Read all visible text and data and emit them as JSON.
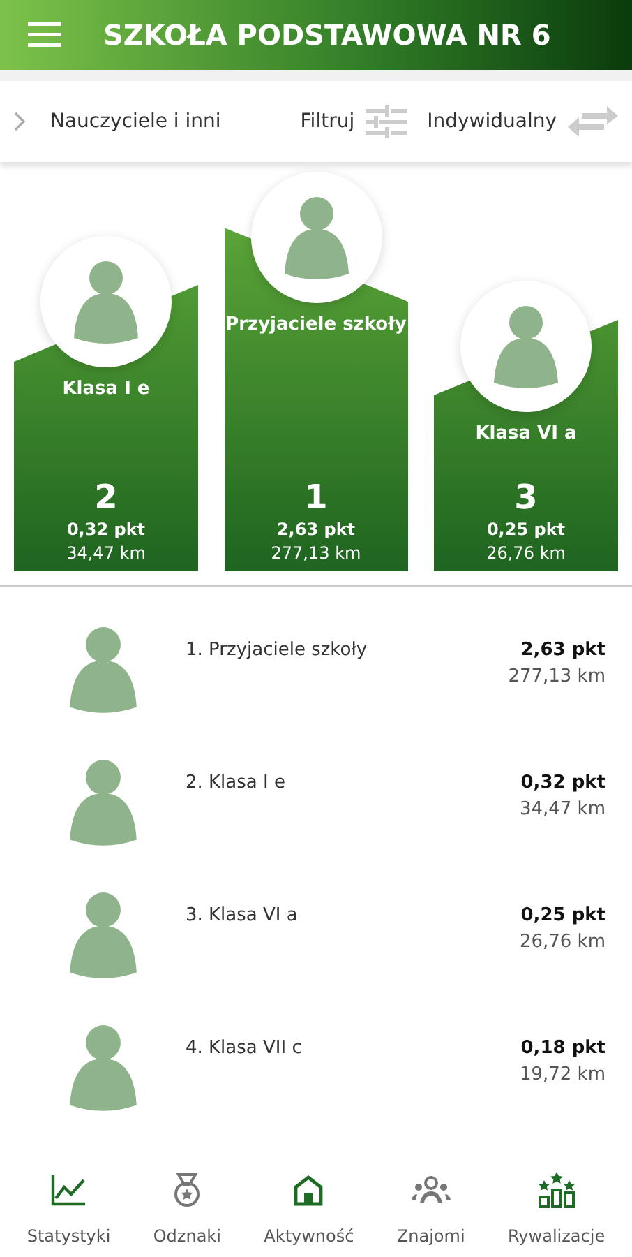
{
  "header": {
    "title": "SZKOŁA PODSTAWOWA NR 6"
  },
  "filter_bar": {
    "group": "Nauczyciele i inni",
    "filter": "Filtruj",
    "mode": "Indywidualny"
  },
  "podium": [
    {
      "name": "Klasa I e",
      "rank": "2",
      "points": "0,32 pkt",
      "distance": "34,47 km"
    },
    {
      "name": "Przyjaciele szkoły",
      "rank": "1",
      "points": "2,63 pkt",
      "distance": "277,13 km"
    },
    {
      "name": "Klasa VI a",
      "rank": "3",
      "points": "0,25 pkt",
      "distance": "26,76 km"
    }
  ],
  "ranking": [
    {
      "name": "1. Przyjaciele szkoły",
      "points": "2,63 pkt",
      "distance": "277,13 km"
    },
    {
      "name": "2. Klasa I e",
      "points": "0,32 pkt",
      "distance": "34,47 km"
    },
    {
      "name": "3. Klasa VI a",
      "points": "0,25 pkt",
      "distance": "26,76 km"
    },
    {
      "name": "4. Klasa VII c",
      "points": "0,18 pkt",
      "distance": "19,72 km"
    }
  ],
  "bottom_nav": [
    {
      "label": "Statystyki",
      "kind": "chart",
      "accent": true
    },
    {
      "label": "Odznaki",
      "kind": "medal",
      "accent": false
    },
    {
      "label": "Aktywność",
      "kind": "home",
      "accent": true
    },
    {
      "label": "Znajomi",
      "kind": "people",
      "accent": false
    },
    {
      "label": "Rywalizacje",
      "kind": "podium",
      "accent": true
    }
  ]
}
